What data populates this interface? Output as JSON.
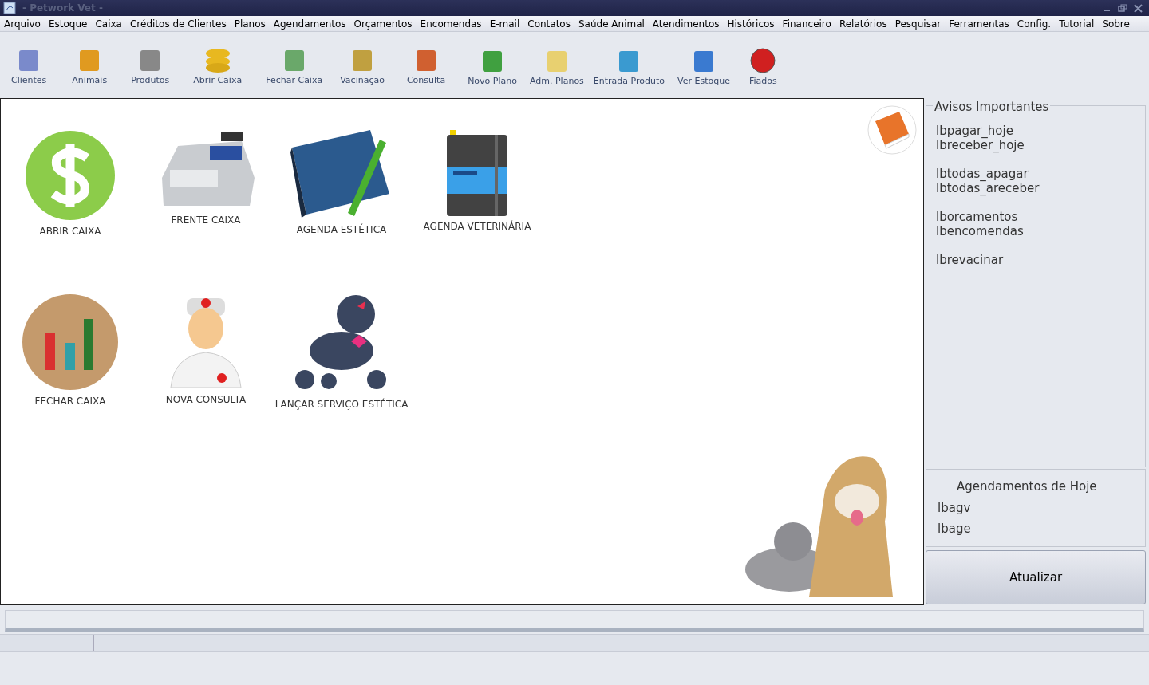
{
  "window": {
    "title": "- Petwork Vet -"
  },
  "menu": [
    "Arquivo",
    "Estoque",
    "Caixa",
    "Créditos de Clientes",
    "Planos",
    "Agendamentos",
    "Orçamentos",
    "Encomendas",
    "E-mail",
    "Contatos",
    "Saúde Animal",
    "Atendimentos",
    "Históricos",
    "Financeiro",
    "Relatórios",
    "Pesquisar",
    "Ferramentas",
    "Config.",
    "Tutorial",
    "Sobre"
  ],
  "toolbar": [
    "Clientes",
    "Animais",
    "Produtos",
    "Abrir Caixa",
    "Fechar Caixa",
    "Vacinação",
    "Consulta",
    "Novo Plano",
    "Adm. Planos",
    "Entrada Produto",
    "Ver Estoque",
    "Fiados"
  ],
  "shortcuts": [
    {
      "label": "ABRIR CAIXA"
    },
    {
      "label": "FRENTE CAIXA"
    },
    {
      "label": "AGENDA ESTÉTICA"
    },
    {
      "label": "AGENDA VETERINÁRIA"
    },
    {
      "label": "FECHAR CAIXA"
    },
    {
      "label": "NOVA CONSULTA"
    },
    {
      "label": "LANÇAR SERVIÇO ESTÉTICA"
    }
  ],
  "notices": {
    "title": "Avisos Importantes",
    "groups": [
      [
        "lbpagar_hoje",
        "lbreceber_hoje"
      ],
      [
        "lbtodas_apagar",
        "lbtodas_areceber"
      ],
      [
        "lborcamentos",
        "lbencomendas"
      ],
      [
        "lbrevacinar"
      ]
    ]
  },
  "appointments": {
    "title": "Agendamentos de Hoje",
    "lines": [
      "lbagv",
      "lbage"
    ]
  },
  "refresh_button": "Atualizar"
}
